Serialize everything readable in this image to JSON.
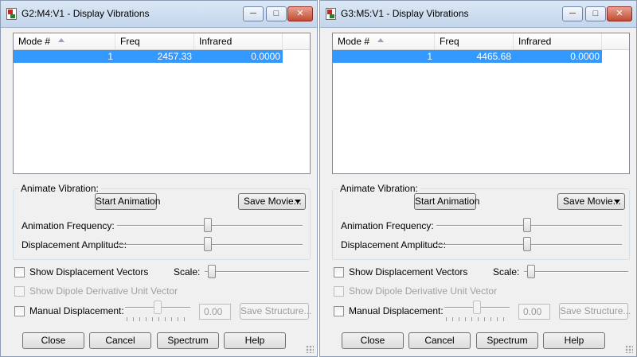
{
  "windows": [
    {
      "title": "G2:M4:V1 - Display Vibrations",
      "caption_buttons": {
        "minimize": "─",
        "maximize": "□",
        "close": "✕"
      },
      "columns": [
        "Mode #",
        "Freq",
        "Infrared"
      ],
      "rows": [
        {
          "mode": "1",
          "freq": "2457.33",
          "infrared": "0.0000"
        }
      ],
      "animate_label": "Animate Vibration:",
      "start_animation": "Start Animation",
      "save_movie": "Save Movie...",
      "anim_freq_label": "Animation Frequency:",
      "disp_amp_label": "Displacement Amplitude:",
      "anim_freq_level": 0.49,
      "disp_amp_level": 0.49,
      "show_vectors": "Show Displacement Vectors",
      "scale_label": "Scale:",
      "scale_level": 0.03,
      "show_dipole": "Show Dipole Derivative Unit Vector",
      "manual_disp": "Manual Displacement:",
      "manual_level": 0.5,
      "manual_value": "0.00",
      "save_structure": "Save Structure...",
      "buttons": {
        "close": "Close",
        "cancel": "Cancel",
        "spectrum": "Spectrum",
        "help": "Help"
      }
    },
    {
      "title": "G3:M5:V1 - Display Vibrations",
      "caption_buttons": {
        "minimize": "─",
        "maximize": "□",
        "close": "✕"
      },
      "columns": [
        "Mode #",
        "Freq",
        "Infrared"
      ],
      "rows": [
        {
          "mode": "1",
          "freq": "4465.68",
          "infrared": "0.0000"
        }
      ],
      "animate_label": "Animate Vibration:",
      "start_animation": "Start Animation",
      "save_movie": "Save Movie...",
      "anim_freq_label": "Animation Frequency:",
      "disp_amp_label": "Displacement Amplitude:",
      "anim_freq_level": 0.49,
      "disp_amp_level": 0.49,
      "show_vectors": "Show Displacement Vectors",
      "scale_label": "Scale:",
      "scale_level": 0.03,
      "show_dipole": "Show Dipole Derivative Unit Vector",
      "manual_disp": "Manual Displacement:",
      "manual_level": 0.5,
      "manual_value": "0.00",
      "save_structure": "Save Structure...",
      "buttons": {
        "close": "Close",
        "cancel": "Cancel",
        "spectrum": "Spectrum",
        "help": "Help"
      }
    }
  ]
}
